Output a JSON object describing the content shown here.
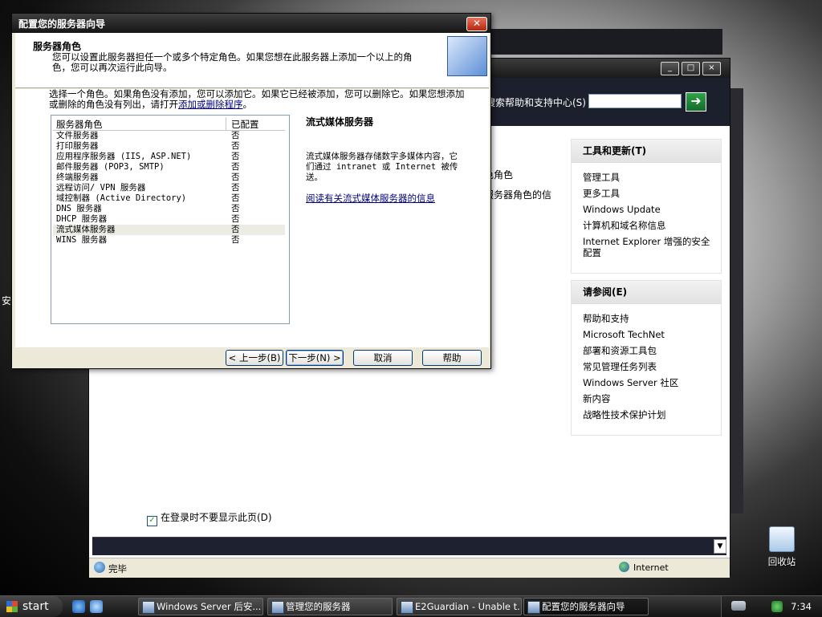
{
  "desktop": {
    "side_text": "安",
    "recycle_bin_label": "回收站"
  },
  "manage_window": {
    "search_label": "搜索帮助和支持中心(S)",
    "search_value": "",
    "search_go_icon": "arrow-right-icon",
    "left_fragment_1": "色角色",
    "left_fragment_2": "服务器角色的信",
    "panel_tools": {
      "header": "工具和更新(T)",
      "items": [
        "管理工具",
        "更多工具",
        "Windows Update",
        "计算机和域名称信息",
        "Internet Explorer 增强的安全配置"
      ]
    },
    "panel_seealso": {
      "header": "请参阅(E)",
      "items": [
        "帮助和支持",
        "Microsoft TechNet",
        "部署和资源工具包",
        "常见管理任务列表",
        "Windows Server 社区",
        "新内容",
        "战略性技术保护计划"
      ]
    },
    "startup_checkbox_label": "在登录时不要显示此页(D)",
    "startup_checkbox_checked": true,
    "status_text": "完毕",
    "zone_text": "Internet"
  },
  "wizard": {
    "title": "配置您的服务器向导",
    "close_icon": "close-icon",
    "header_title": "服务器角色",
    "header_subtitle": "您可以设置此服务器担任一个或多个特定角色。如果您想在此服务器上添加一个以上的角色，您可以再次运行此向导。",
    "instruction_text": "选择一个角色。如果角色没有添加，您可以添加它。如果它已经被添加，您可以删除它。如果您想添加或删除的角色没有列出，请打开",
    "instruction_link": "添加或删除程序",
    "instruction_end": "。",
    "list_header_role": "服务器角色",
    "list_header_configured": "已配置",
    "roles": [
      {
        "name": "文件服务器",
        "configured": "否"
      },
      {
        "name": "打印服务器",
        "configured": "否"
      },
      {
        "name": "应用程序服务器 (IIS, ASP.NET)",
        "configured": "否"
      },
      {
        "name": "邮件服务器 (POP3, SMTP)",
        "configured": "否"
      },
      {
        "name": "终端服务器",
        "configured": "否"
      },
      {
        "name": "远程访问/ VPN 服务器",
        "configured": "否"
      },
      {
        "name": "域控制器 (Active Directory)",
        "configured": "否"
      },
      {
        "name": "DNS 服务器",
        "configured": "否"
      },
      {
        "name": "DHCP 服务器",
        "configured": "否"
      },
      {
        "name": "流式媒体服务器",
        "configured": "否"
      },
      {
        "name": "WINS 服务器",
        "configured": "否"
      }
    ],
    "selected_role_index": 9,
    "detail_title": "流式媒体服务器",
    "detail_description": "流式媒体服务器存储数字多媒体内容，它们通过 intranet 或 Internet 被传送。",
    "detail_link": "阅读有关流式媒体服务器的信息",
    "btn_back": "< 上一步(B)",
    "btn_next": "下一步(N) >",
    "btn_cancel": "取消",
    "btn_help": "帮助"
  },
  "taskbar": {
    "start_label": "start",
    "tasks": [
      {
        "label": "Windows Server 后安..."
      },
      {
        "label": "管理您的服务器"
      },
      {
        "label": "E2Guardian - Unable t..."
      },
      {
        "label": "配置您的服务器向导"
      }
    ],
    "active_task_index": 3,
    "clock": "7:34"
  }
}
